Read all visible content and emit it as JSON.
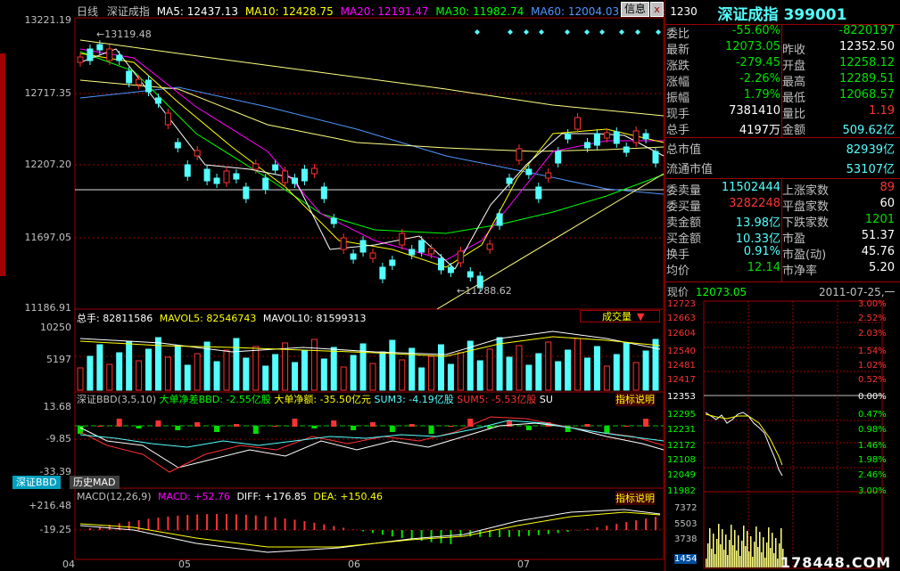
{
  "colors": {
    "up": "#ff3232",
    "down": "#54ffff",
    "ma5": "#ffffff",
    "ma10": "#ffff00",
    "ma20": "#ff00ff",
    "ma30": "#00ff00",
    "ma60": "#5096ff",
    "ma120": "#ffff80",
    "grid": "#a00000",
    "bg": "#000000"
  },
  "header": {
    "period": "日线",
    "name": "深证成指",
    "ma5": "MA5: 12437.13",
    "ma10": "MA10: 12428.75",
    "ma20": "MA20: 12191.47",
    "ma30": "MA30: 11982.74",
    "ma60": "MA60: 12004.03",
    "ma120": "MA120: 1230",
    "info_button": "信息",
    "close_button": "x"
  },
  "price_axis": [
    "13221.19",
    "12717.35",
    "12207.20",
    "11697.05",
    "11186.91"
  ],
  "price_marks": {
    "high": "13119.48",
    "low": "11288.62"
  },
  "volume_header": {
    "total": "总手: 82811586",
    "mavol5": "MAVOL5: 82546743",
    "mavol10": "MAVOL10: 81599313",
    "dropdown": "成交量"
  },
  "volume_axis": [
    "10250",
    "5197"
  ],
  "bbd_header": {
    "title": "深证BBD(3,5,10)",
    "diff": "大单净差BBD: -2.55亿股",
    "net": "大单净额: -35.50亿元",
    "sum3": "SUM3: -4.19亿股",
    "sum5": "SUM5: -5.53亿股",
    "more": "SU",
    "explain": "指标说明"
  },
  "bbd_axis": [
    "13.68",
    "-9.85",
    "-33.39"
  ],
  "bottom_tabs": [
    "深证BBD",
    "历史MAD"
  ],
  "macd_header": {
    "title": "MACD(12,26,9)",
    "macd": "MACD: +52.76",
    "diff": "DIFF: +176.85",
    "dea": "DEA: +150.46",
    "explain": "指标说明"
  },
  "macd_axis": [
    "+216.48",
    "-19.25"
  ],
  "months": [
    "04",
    "05",
    "06",
    "07"
  ],
  "panel": {
    "title": "深证成指 399001",
    "rows": [
      {
        "k": "委比",
        "v": "-55.60%",
        "vc": "green",
        "k2": "",
        "v2": "-8220197",
        "v2c": "green"
      },
      {
        "k": "最新",
        "v": "12073.05",
        "vc": "green",
        "k2": "昨收",
        "v2": "12352.50",
        "v2c": "white"
      },
      {
        "k": "涨跌",
        "v": "-279.45",
        "vc": "green",
        "k2": "开盘",
        "v2": "12258.12",
        "v2c": "green"
      },
      {
        "k": "涨幅",
        "v": "-2.26%",
        "vc": "green",
        "k2": "最高",
        "v2": "12289.51",
        "v2c": "green"
      },
      {
        "k": "振幅",
        "v": "1.79%",
        "vc": "green",
        "k2": "最低",
        "v2": "12068.57",
        "v2c": "green"
      },
      {
        "k": "现手",
        "v": "7381410",
        "vc": "white",
        "k2": "量比",
        "v2": "1.19",
        "v2c": "red"
      },
      {
        "k": "总手",
        "v": "4197万",
        "vc": "white",
        "k2": "金额",
        "v2": "509.62亿",
        "v2c": "cyan"
      }
    ],
    "mcap": [
      {
        "k": "总市值",
        "v": "82939亿"
      },
      {
        "k": "流通市值",
        "v": "53107亿"
      }
    ],
    "rows2": [
      {
        "k": "委卖量",
        "v": "11502444",
        "vc": "cyan",
        "k2": "上涨家数",
        "v2": "89",
        "v2c": "red"
      },
      {
        "k": "委买量",
        "v": "3282248",
        "vc": "red",
        "k2": "平盘家数",
        "v2": "60",
        "v2c": "white"
      },
      {
        "k": "卖金额",
        "v": "13.98亿",
        "vc": "cyan",
        "k2": "下跌家数",
        "v2": "1201",
        "v2c": "green"
      },
      {
        "k": "买金额",
        "v": "10.33亿",
        "vc": "cyan",
        "k2": "市盈",
        "v2": "51.37",
        "v2c": "white"
      },
      {
        "k": "换手",
        "v": "0.91%",
        "vc": "cyan",
        "k2": "市盈(动)",
        "v2": "45.76",
        "v2c": "white"
      },
      {
        "k": "均价",
        "v": "12.14",
        "vc": "green",
        "k2": "市净率",
        "v2": "5.20",
        "v2c": "white"
      }
    ],
    "intraday_label": "现价",
    "intraday_price": "12073.05",
    "intraday_date": "2011-07-25,一",
    "intraday_left": [
      "12723",
      "12663",
      "12604",
      "12540",
      "12481",
      "12417",
      "12353",
      "12295",
      "12231",
      "12172",
      "12108",
      "12049",
      "11982"
    ],
    "intraday_right": [
      "3.00%",
      "2.52%",
      "2.03%",
      "1.54%",
      "1.02%",
      "0.52%",
      "0.00%",
      "0.47%",
      "0.98%",
      "1.46%",
      "1.98%",
      "2.46%",
      "3.00%"
    ],
    "intraday_vol": [
      "7372",
      "5503",
      "3738",
      "1454"
    ],
    "watermark": "178448.COM"
  }
}
